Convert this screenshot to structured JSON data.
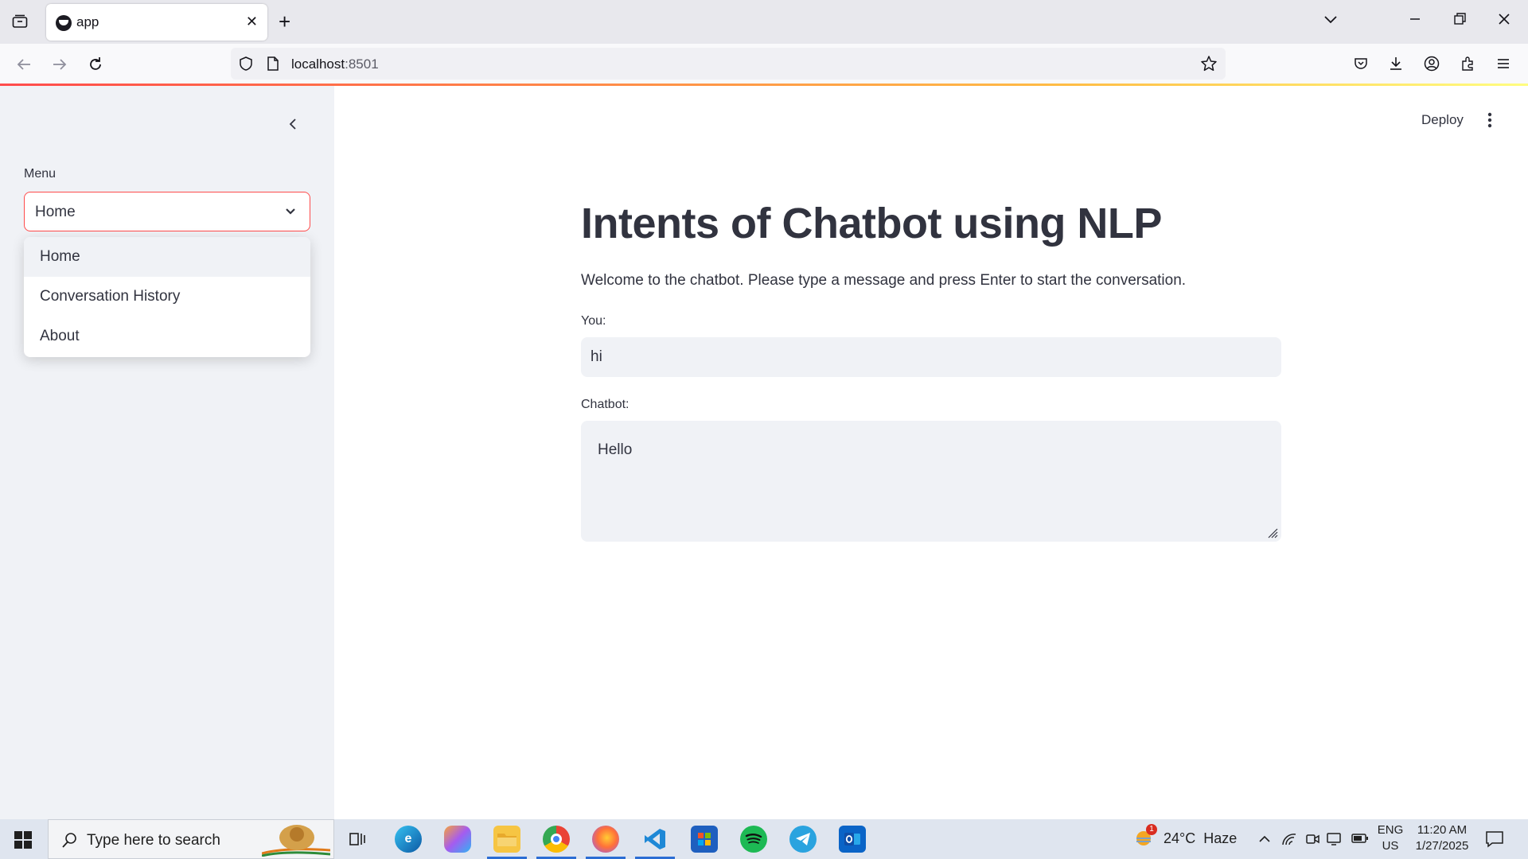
{
  "browser": {
    "tab_title": "app",
    "url_host": "localhost",
    "url_port": ":8501"
  },
  "sidebar": {
    "menu_label": "Menu",
    "selected": "Home",
    "options": [
      "Home",
      "Conversation History",
      "About"
    ]
  },
  "header": {
    "deploy_label": "Deploy"
  },
  "main": {
    "title": "Intents of Chatbot using NLP",
    "welcome": "Welcome to the chatbot. Please type a message and press Enter to start the conversation.",
    "you_label": "You:",
    "you_value": "hi",
    "bot_label": "Chatbot:",
    "bot_value": "Hello"
  },
  "taskbar": {
    "search_placeholder": "Type here to search",
    "weather": "24°C  Haze",
    "weather_badge": "1",
    "lang_top": "ENG",
    "lang_bottom": "US",
    "time": "11:20 AM",
    "date": "1/27/2025"
  },
  "colors": {
    "accent": "#ff4b4b",
    "sidebar_bg": "#f0f2f6",
    "text": "#31333f"
  }
}
